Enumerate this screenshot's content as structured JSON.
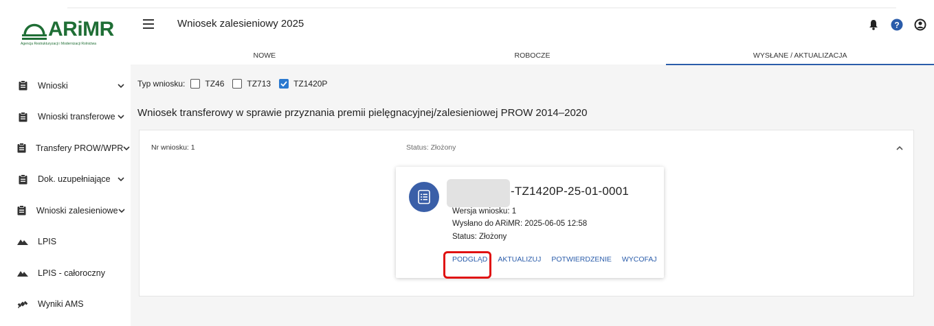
{
  "logo": {
    "name": "ARiMR",
    "subtitle": "Agencja Restrukturyzacji i Modernizacji Rolnictwa"
  },
  "sidebar": {
    "items": [
      {
        "label": "Wnioski",
        "icon": "clipboard-icon",
        "has_chevron": true
      },
      {
        "label": "Wnioski transferowe",
        "icon": "clipboard-icon",
        "has_chevron": true
      },
      {
        "label": "Transfery PROW/WPR",
        "icon": "clipboard-icon",
        "has_chevron": true
      },
      {
        "label": "Dok. uzupełniające",
        "icon": "clipboard-icon",
        "has_chevron": true
      },
      {
        "label": "Wnioski zalesieniowe",
        "icon": "clipboard-icon",
        "has_chevron": true
      },
      {
        "label": "LPIS",
        "icon": "terrain-icon",
        "has_chevron": false
      },
      {
        "label": "LPIS - całoroczny",
        "icon": "terrain-icon",
        "has_chevron": false
      },
      {
        "label": "Wyniki AMS",
        "icon": "satellite-icon",
        "has_chevron": false
      }
    ]
  },
  "header": {
    "title": "Wniosek zalesieniowy 2025"
  },
  "tabs": [
    {
      "label": "NOWE",
      "active": false
    },
    {
      "label": "ROBOCZE",
      "active": false
    },
    {
      "label": "WYSŁANE / AKTUALIZACJA",
      "active": true
    }
  ],
  "filter": {
    "label": "Typ wniosku:",
    "options": [
      {
        "label": "TZ46",
        "checked": false
      },
      {
        "label": "TZ713",
        "checked": false
      },
      {
        "label": "TZ1420P",
        "checked": true
      }
    ]
  },
  "section": {
    "title": "Wniosek transferowy w sprawie przyznania premii pielęgnacyjnej/zalesieniowej PROW 2014–2020"
  },
  "panel": {
    "number_label": "Nr wniosku: 1",
    "status_label": "Status: Złożony"
  },
  "card": {
    "id_suffix": "-TZ1420P-25-01-0001",
    "version": "Wersja wniosku: 1",
    "sent": "Wysłano do ARiMR: 2025-06-05 12:58",
    "status": "Status: Złożony",
    "actions": [
      "PODGLĄD",
      "AKTUALIZUJ",
      "POTWIERDZENIE",
      "WYCOFAJ"
    ]
  },
  "colors": {
    "brand_green": "#1f6e35",
    "primary_blue": "#2a5caa",
    "highlight_red": "#e01010"
  }
}
